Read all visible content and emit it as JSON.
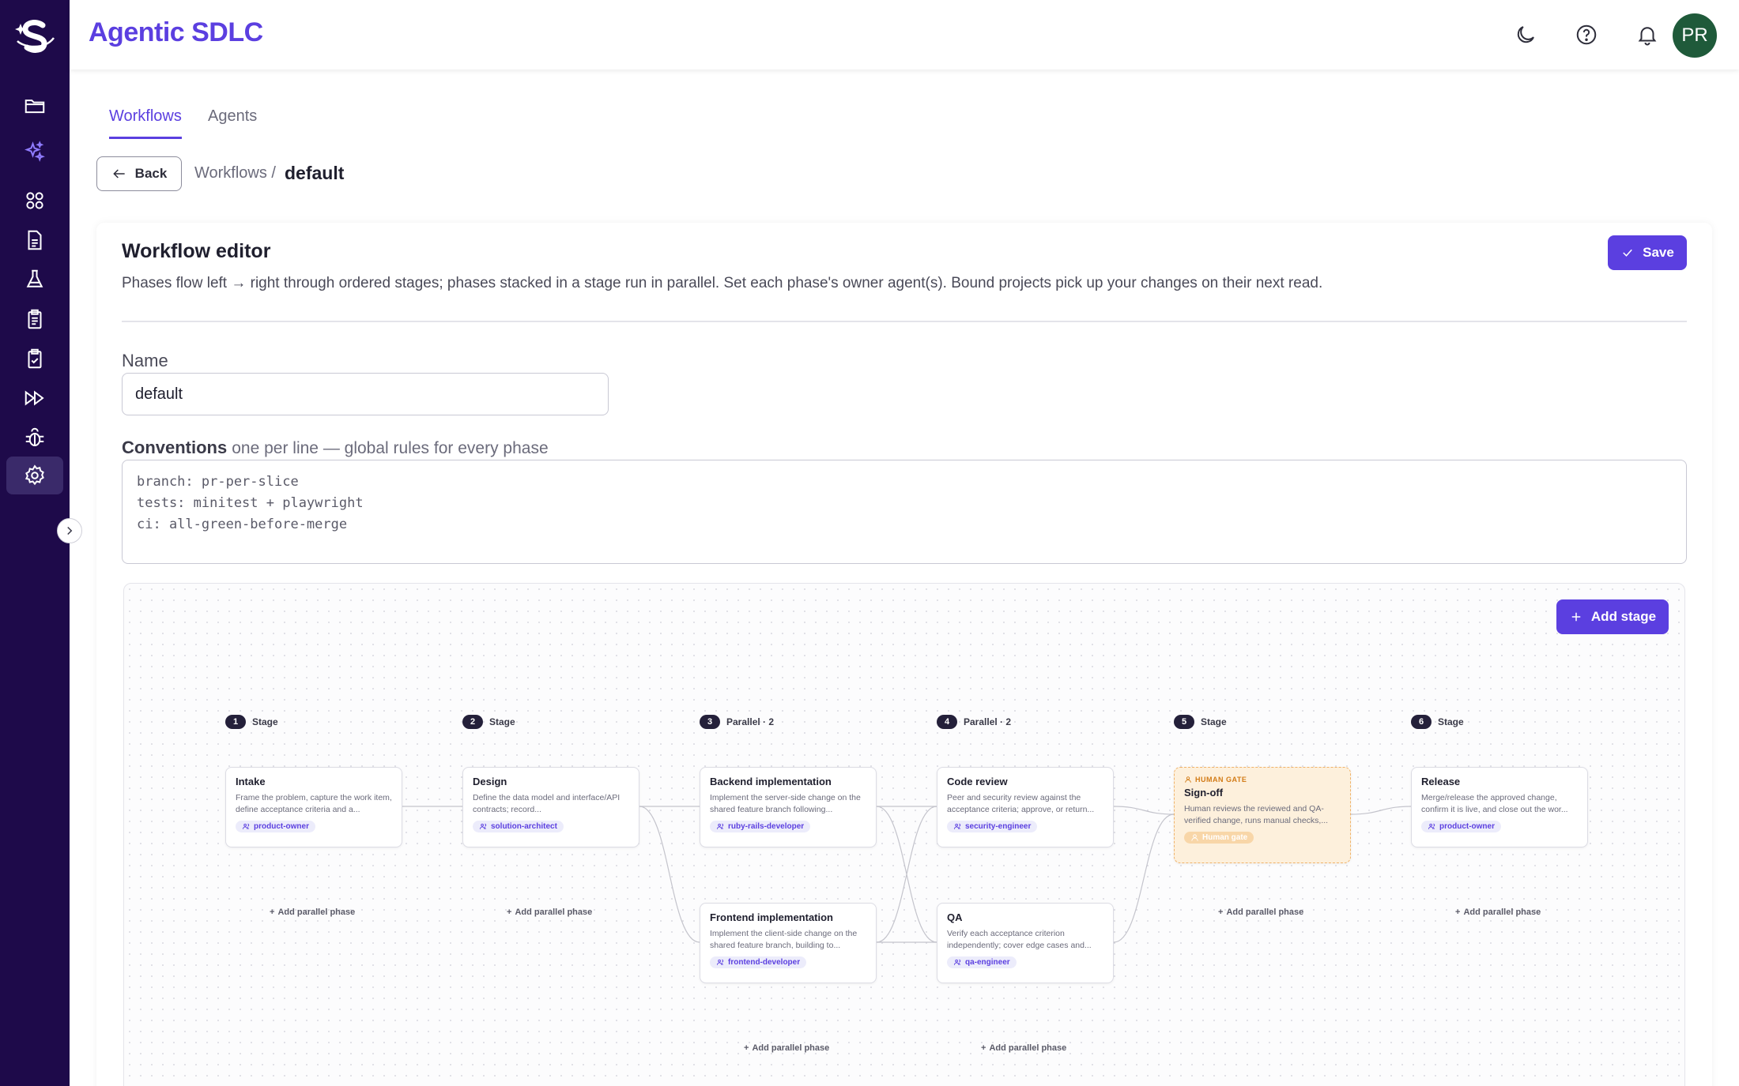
{
  "app": {
    "title": "Agentic SDLC",
    "avatar": "PR"
  },
  "sidebar": {
    "items": [
      "folder-icon",
      "sparkles-icon",
      "apps-grid-icon",
      "document-icon",
      "flask-icon",
      "clipboard-list-icon",
      "clipboard-check-icon",
      "fast-forward-icon",
      "bug-icon",
      "settings-icon"
    ],
    "active": "settings-icon"
  },
  "header": {
    "icons": [
      "moon-icon",
      "help-icon",
      "bell-icon"
    ]
  },
  "tabs": [
    {
      "label": "Workflows",
      "active": true
    },
    {
      "label": "Agents",
      "active": false
    }
  ],
  "breadcrumb": {
    "back": "Back",
    "parent": "Workflows /",
    "current": "default"
  },
  "editor": {
    "title": "Workflow editor",
    "description": "Phases flow left → right through ordered stages; phases stacked in a stage run in parallel. Set each phase's owner agent(s). Bound projects pick up your changes on their next read.",
    "save": "Save",
    "name_label": "Name",
    "name_value": "default",
    "conventions_label": "Conventions",
    "conventions_hint": "one per line — global rules for every phase",
    "conventions": [
      "branch: pr-per-slice",
      "tests: minitest + playwright",
      "ci: all-green-before-merge"
    ]
  },
  "canvas": {
    "add_stage": "Add stage",
    "add_parallel": "Add parallel phase",
    "stages": [
      {
        "num": "1",
        "label": "Stage",
        "phases": [
          {
            "title": "Intake",
            "desc": "Frame the problem, capture the work item, define acceptance criteria and a...",
            "owner": "product-owner"
          }
        ]
      },
      {
        "num": "2",
        "label": "Stage",
        "phases": [
          {
            "title": "Design",
            "desc": "Define the data model and interface/API contracts; record...",
            "owner": "solution-architect"
          }
        ]
      },
      {
        "num": "3",
        "label": "Parallel · 2",
        "phases": [
          {
            "title": "Backend implementation",
            "desc": "Implement the server-side change on the shared feature branch following...",
            "owner": "ruby-rails-developer"
          },
          {
            "title": "Frontend implementation",
            "desc": "Implement the client-side change on the shared feature branch, building to...",
            "owner": "frontend-developer"
          }
        ]
      },
      {
        "num": "4",
        "label": "Parallel · 2",
        "phases": [
          {
            "title": "Code review",
            "desc": "Peer and security review against the acceptance criteria; approve, or return...",
            "owner": "security-engineer"
          },
          {
            "title": "QA",
            "desc": "Verify each acceptance criterion independently; cover edge cases and...",
            "owner": "qa-engineer"
          }
        ]
      },
      {
        "num": "5",
        "label": "Stage",
        "phases": [
          {
            "gate": "HUMAN GATE",
            "title": "Sign-off",
            "desc": "Human reviews the reviewed and QA-verified change, runs manual checks,...",
            "owner": "Human gate"
          }
        ]
      },
      {
        "num": "6",
        "label": "Stage",
        "phases": [
          {
            "title": "Release",
            "desc": "Merge/release the approved change, confirm it is live, and close out the wor...",
            "owner": "product-owner"
          }
        ]
      }
    ]
  }
}
